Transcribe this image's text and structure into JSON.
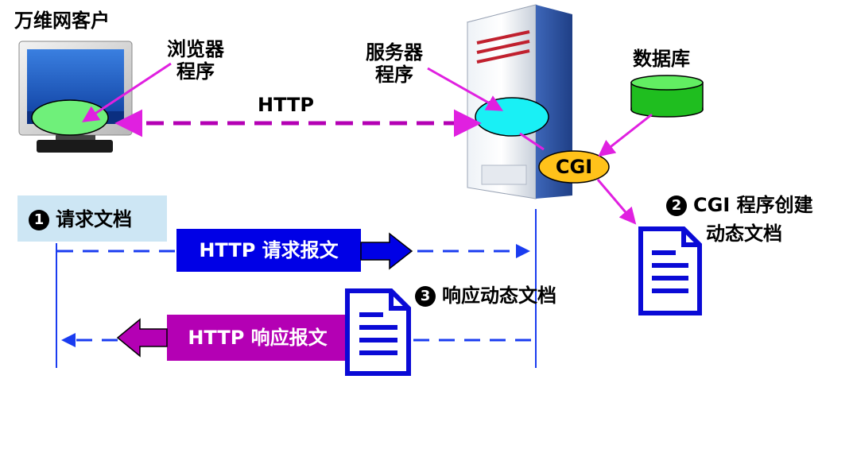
{
  "client": {
    "title": "万维网客户",
    "browser_label_1": "浏览器",
    "browser_label_2": "程序"
  },
  "server": {
    "label_1": "服务器",
    "label_2": "程序"
  },
  "database": {
    "label": "数据库"
  },
  "protocol": {
    "label": "HTTP"
  },
  "cgi": {
    "label": "CGI"
  },
  "steps": [
    {
      "badge": "1",
      "text": "请求文档"
    },
    {
      "badge": "2",
      "text_1": "CGI 程序创建",
      "text_2": "动态文档"
    },
    {
      "badge": "3",
      "text": "响应动态文档"
    }
  ],
  "messages": {
    "request": "HTTP 请求报文",
    "response": "HTTP 响应报文"
  },
  "colors": {
    "magenta": "#e020e0",
    "request_blue": "#0000e6",
    "response_purple": "#b400b4",
    "dash_blue": "#1a3cf0",
    "browser_ellipse": "#6ff07a",
    "server_ellipse": "#19f0f5",
    "cgi_fill": "#ffc21a",
    "db_green": "#2ad62a",
    "step1_bg": "#cde6f4"
  }
}
